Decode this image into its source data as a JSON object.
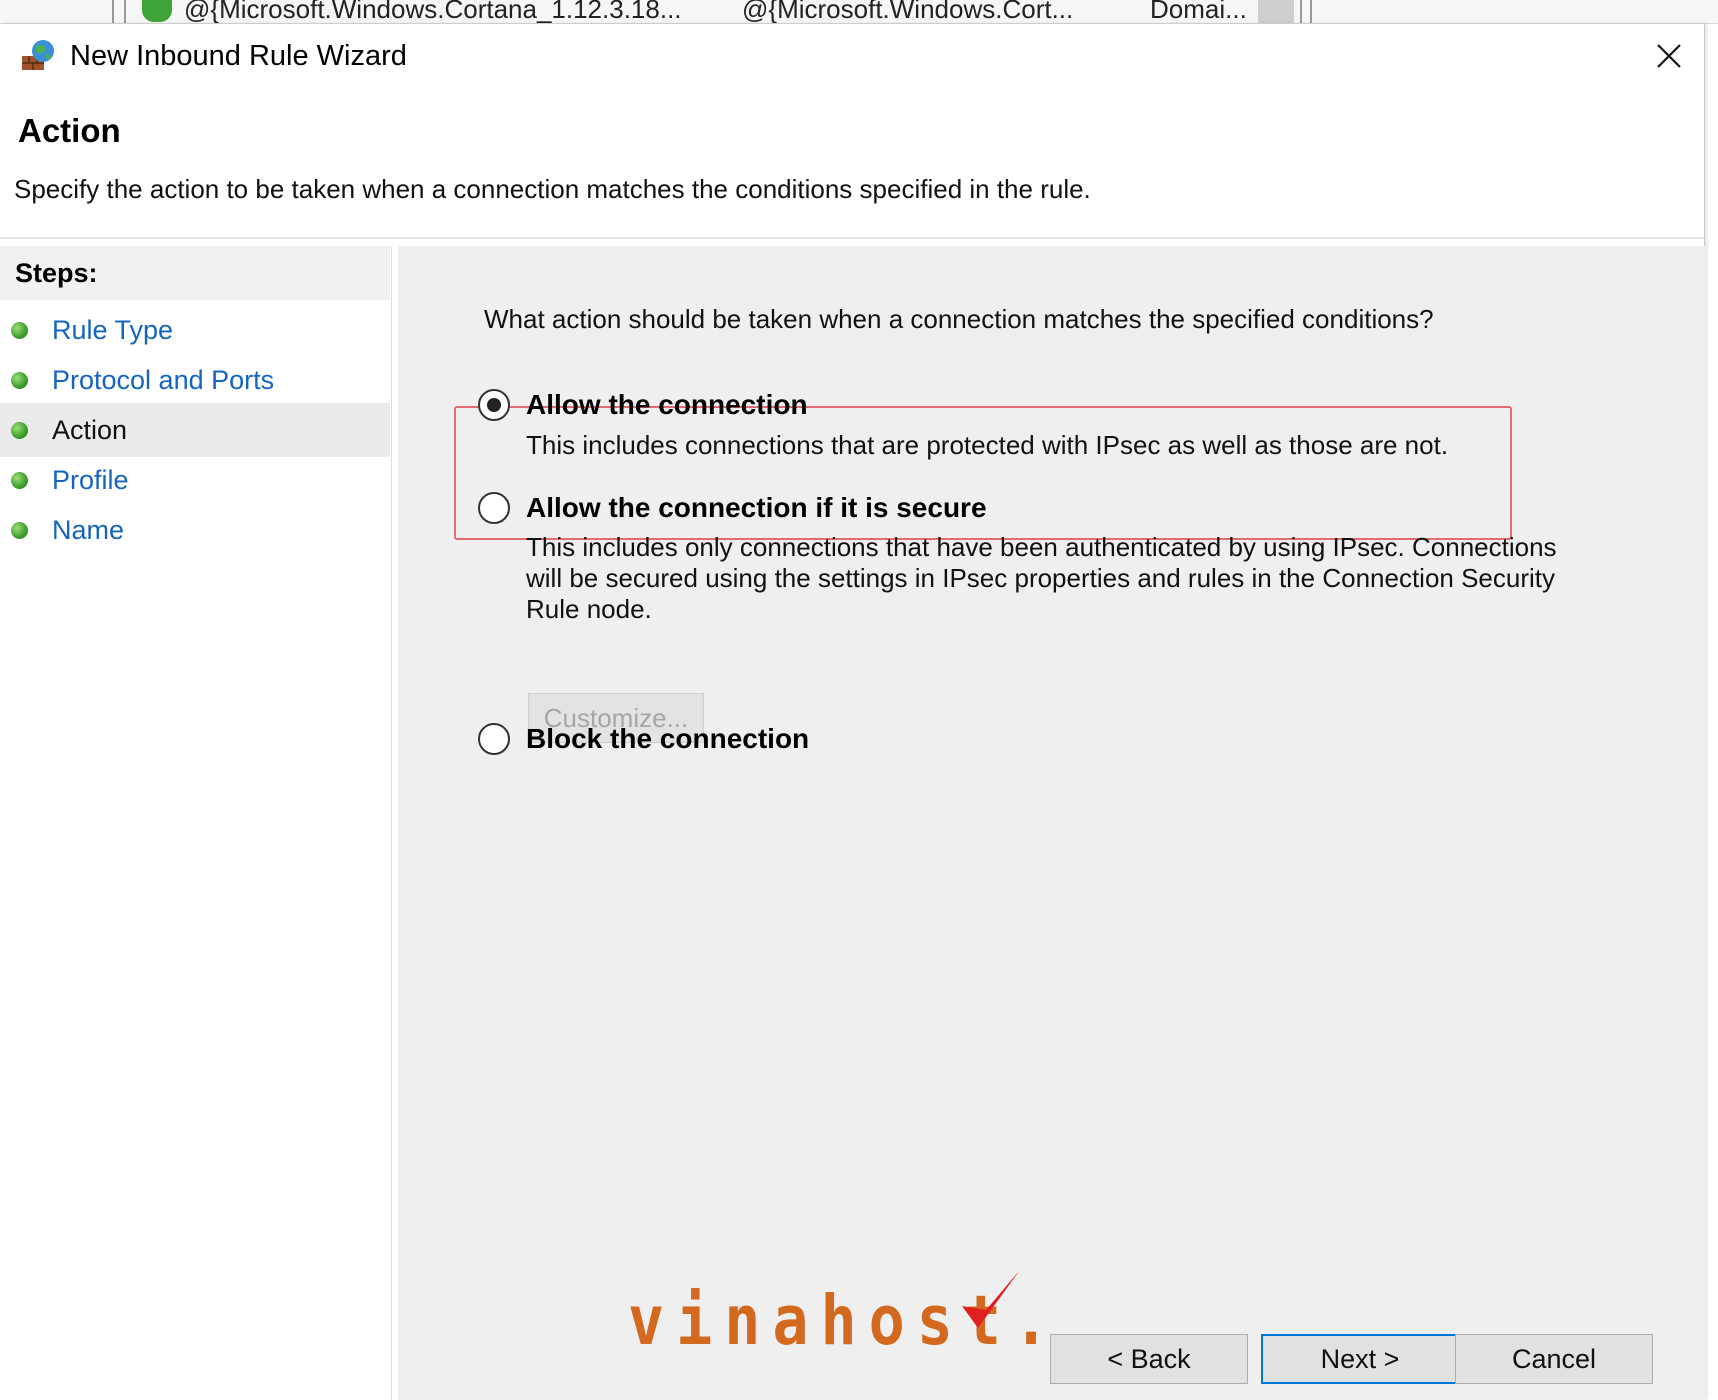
{
  "background_window": {
    "cells": [
      "@{Microsoft.Windows.Cortana_1.12.3.18...",
      "@{Microsoft.Windows.Cort...",
      "Domai..."
    ]
  },
  "window": {
    "title": "New Inbound Rule Wizard",
    "icon": "firewall-globe-icon",
    "close_icon": "close-icon"
  },
  "header": {
    "title": "Action",
    "description": "Specify the action to be taken when a connection matches the conditions specified in the rule."
  },
  "steps": {
    "heading": "Steps:",
    "items": [
      {
        "label": "Rule Type",
        "current": false
      },
      {
        "label": "Protocol and Ports",
        "current": false
      },
      {
        "label": "Action",
        "current": true
      },
      {
        "label": "Profile",
        "current": false
      },
      {
        "label": "Name",
        "current": false
      }
    ]
  },
  "main": {
    "question": "What action should be taken when a connection matches the specified conditions?",
    "options": [
      {
        "label": "Allow the connection",
        "description": "This includes connections that are protected with IPsec as well as those are not.",
        "selected": true
      },
      {
        "label": "Allow the connection if it is secure",
        "description": "This includes only connections that have been authenticated by using IPsec.  Connections will be secured using the settings in IPsec properties and rules in the Connection Security Rule node.",
        "selected": false
      },
      {
        "label": "Block the connection",
        "description": "",
        "selected": false
      }
    ],
    "customize_label": "Customize..."
  },
  "watermark": {
    "text": "vinahost."
  },
  "footer": {
    "back_label": "< Back",
    "next_label": "Next >",
    "cancel_label": "Cancel"
  },
  "colors": {
    "link": "#1565c0",
    "highlight_border": "#e36a72",
    "default_button_border": "#0078d7",
    "step_dot": "#3c9c2a",
    "watermark": "#d2691e",
    "watermark_check": "#e02020"
  }
}
